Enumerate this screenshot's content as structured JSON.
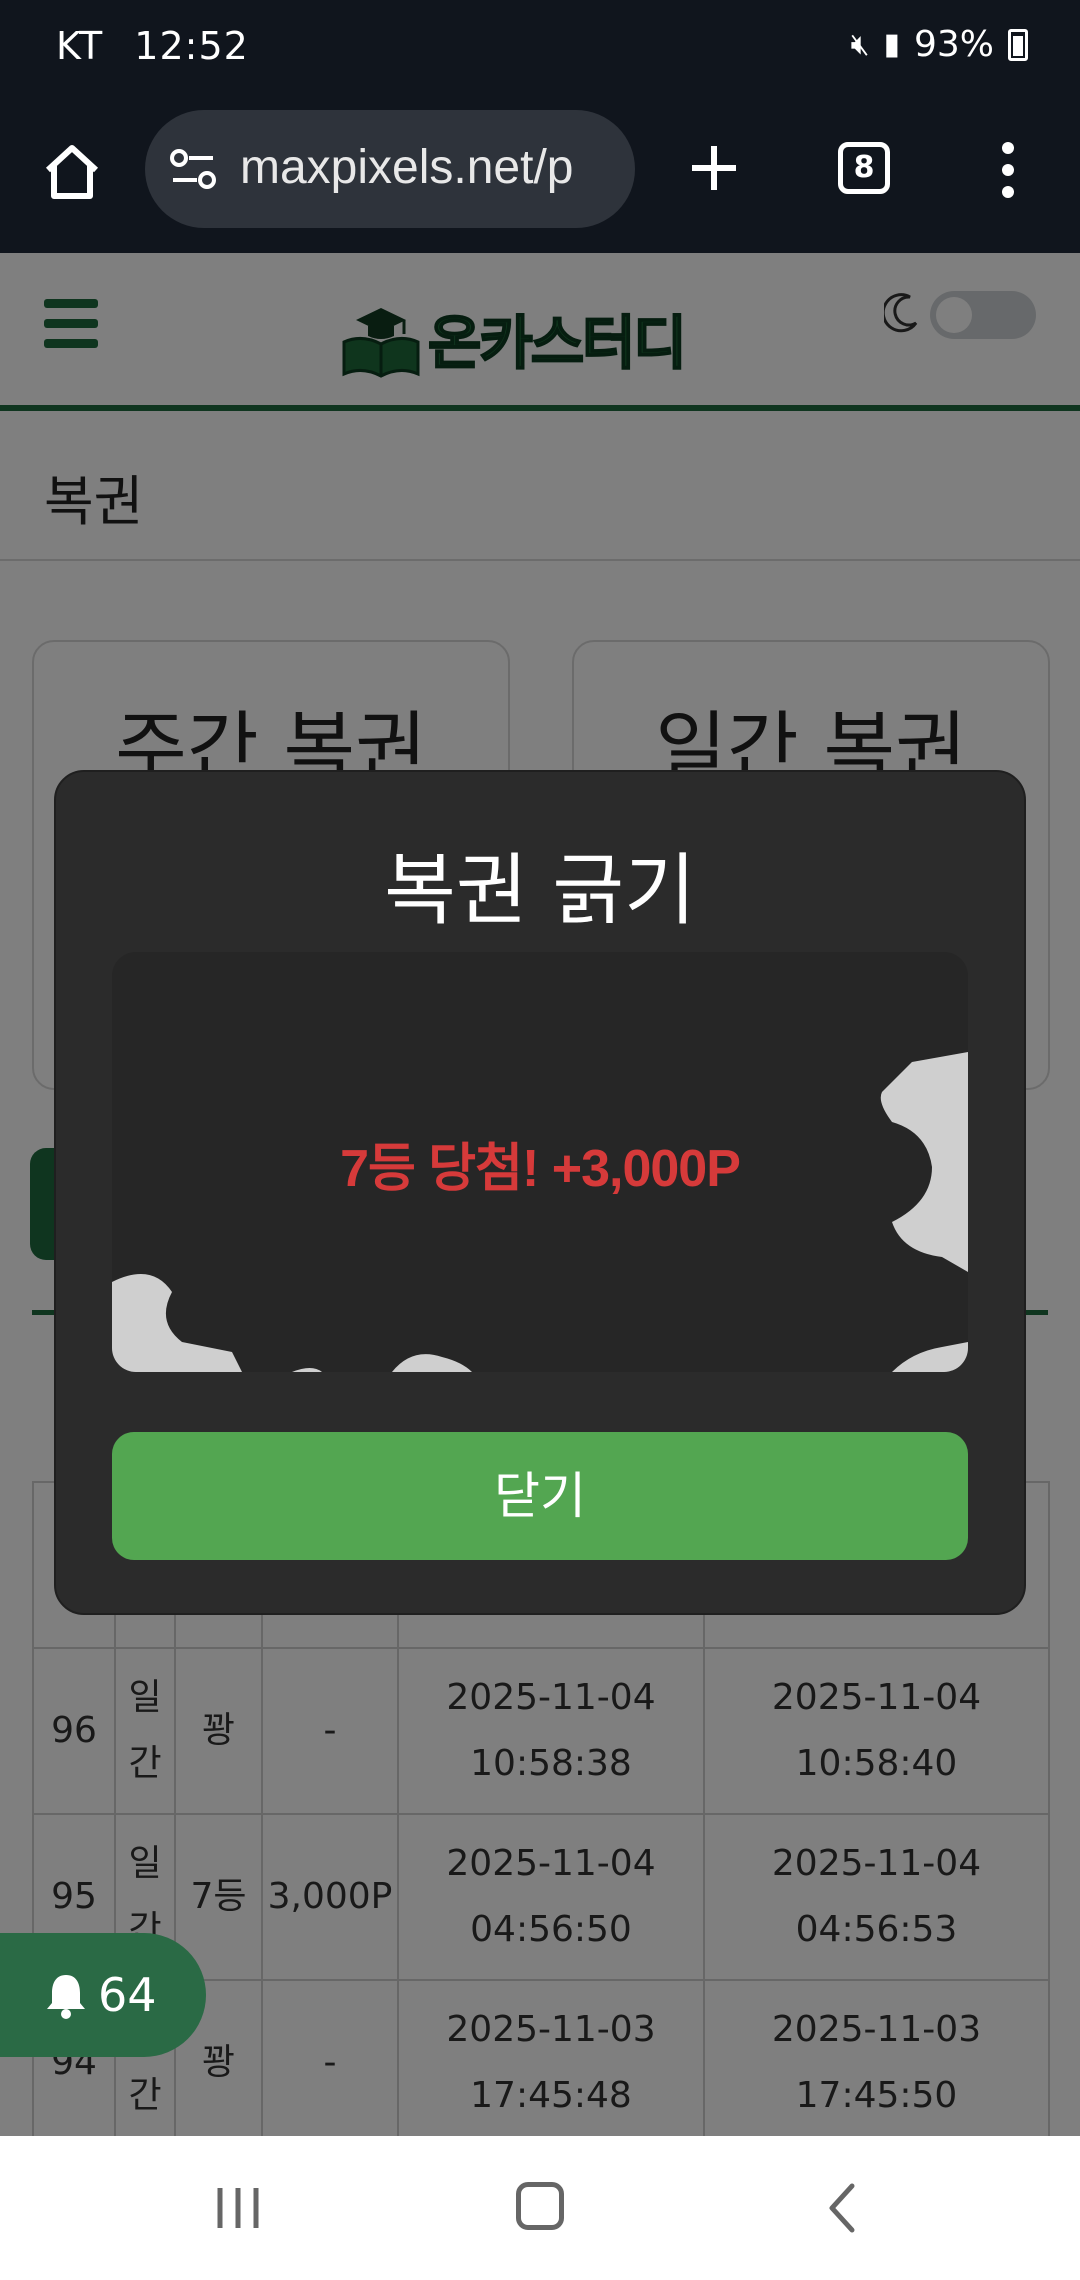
{
  "status_bar": {
    "carrier": "KT",
    "time": "12:52",
    "battery": "93%"
  },
  "browser": {
    "url": "maxpixels.net/p",
    "tab_count": "8"
  },
  "site": {
    "logo_text": "온카스터디",
    "breadcrumb": "복권"
  },
  "cards": [
    {
      "title": "주간 복권"
    },
    {
      "title": "일간 복권"
    }
  ],
  "history": {
    "rows": [
      {
        "no": "96",
        "kind": "일간",
        "rank": "꽝",
        "points": "-",
        "created": "2025-11-04 10:58:38",
        "scratched": "2025-11-04 10:58:40"
      },
      {
        "no": "95",
        "kind": "일간",
        "rank": "7등",
        "points": "3,000P",
        "created": "2025-11-04 04:56:50",
        "scratched": "2025-11-04 04:56:53"
      },
      {
        "no": "94",
        "kind": "일간",
        "rank": "꽝",
        "points": "-",
        "created": "2025-11-03 17:45:48",
        "scratched": "2025-11-03 17:45:50"
      }
    ]
  },
  "notification": {
    "count": "64"
  },
  "modal": {
    "title": "복권 긁기",
    "prize_text": "7등 당첨! +3,000P",
    "close_label": "닫기"
  },
  "colors": {
    "brand_green": "#1f6b3e",
    "button_green": "#53a651",
    "prize_red": "#d63a3a"
  }
}
